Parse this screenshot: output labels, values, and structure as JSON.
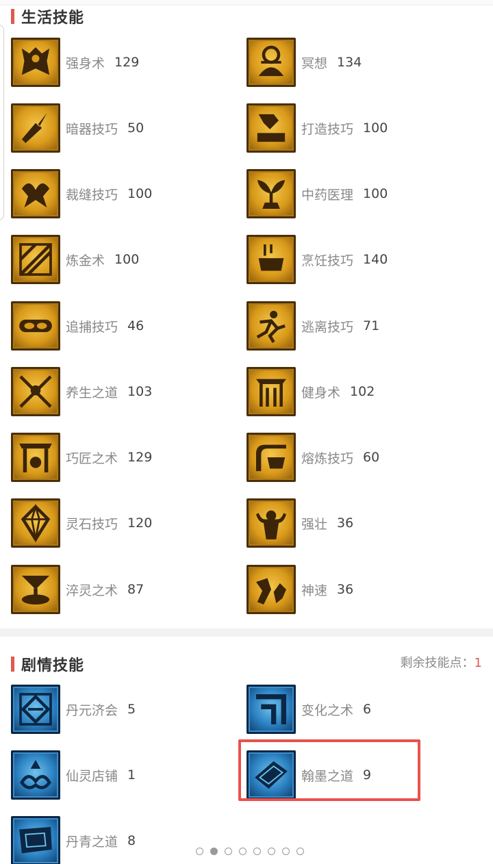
{
  "life_section": {
    "title": "生活技能",
    "skills": [
      {
        "name": "强身术",
        "value": "129",
        "icon": "strength-icon"
      },
      {
        "name": "冥想",
        "value": "134",
        "icon": "meditation-icon"
      },
      {
        "name": "暗器技巧",
        "value": "50",
        "icon": "hidden-weapon-icon"
      },
      {
        "name": "打造技巧",
        "value": "100",
        "icon": "forging-hammer-icon"
      },
      {
        "name": "裁缝技巧",
        "value": "100",
        "icon": "tailoring-scissors-icon"
      },
      {
        "name": "中药医理",
        "value": "100",
        "icon": "herb-medicine-icon"
      },
      {
        "name": "炼金术",
        "value": "100",
        "icon": "alchemy-icon"
      },
      {
        "name": "烹饪技巧",
        "value": "140",
        "icon": "cooking-pot-icon"
      },
      {
        "name": "追捕技巧",
        "value": "46",
        "icon": "pursuit-icon"
      },
      {
        "name": "逃离技巧",
        "value": "71",
        "icon": "escape-icon"
      },
      {
        "name": "养生之道",
        "value": "103",
        "icon": "health-keeping-icon"
      },
      {
        "name": "健身术",
        "value": "102",
        "icon": "fitness-icon"
      },
      {
        "name": "巧匠之术",
        "value": "129",
        "icon": "craftsman-icon"
      },
      {
        "name": "熔炼技巧",
        "value": "60",
        "icon": "smelting-icon"
      },
      {
        "name": "灵石技巧",
        "value": "120",
        "icon": "spirit-stone-icon"
      },
      {
        "name": "强壮",
        "value": "36",
        "icon": "muscle-icon"
      },
      {
        "name": "淬灵之术",
        "value": "87",
        "icon": "quench-spirit-icon"
      },
      {
        "name": "神速",
        "value": "36",
        "icon": "swiftness-icon"
      }
    ]
  },
  "story_section": {
    "title": "剧情技能",
    "remaining_label": "剩余技能点：",
    "remaining_value": "1",
    "skills": [
      {
        "name": "丹元济会",
        "value": "5",
        "icon": "danyuan-icon"
      },
      {
        "name": "变化之术",
        "value": "6",
        "icon": "transformation-icon"
      },
      {
        "name": "仙灵店铺",
        "value": "1",
        "icon": "spirit-shop-icon"
      },
      {
        "name": "翰墨之道",
        "value": "9",
        "icon": "ink-book-icon"
      },
      {
        "name": "丹青之道",
        "value": "8",
        "icon": "painting-scroll-icon"
      }
    ]
  },
  "pagination": {
    "total": 8,
    "active": 1
  }
}
